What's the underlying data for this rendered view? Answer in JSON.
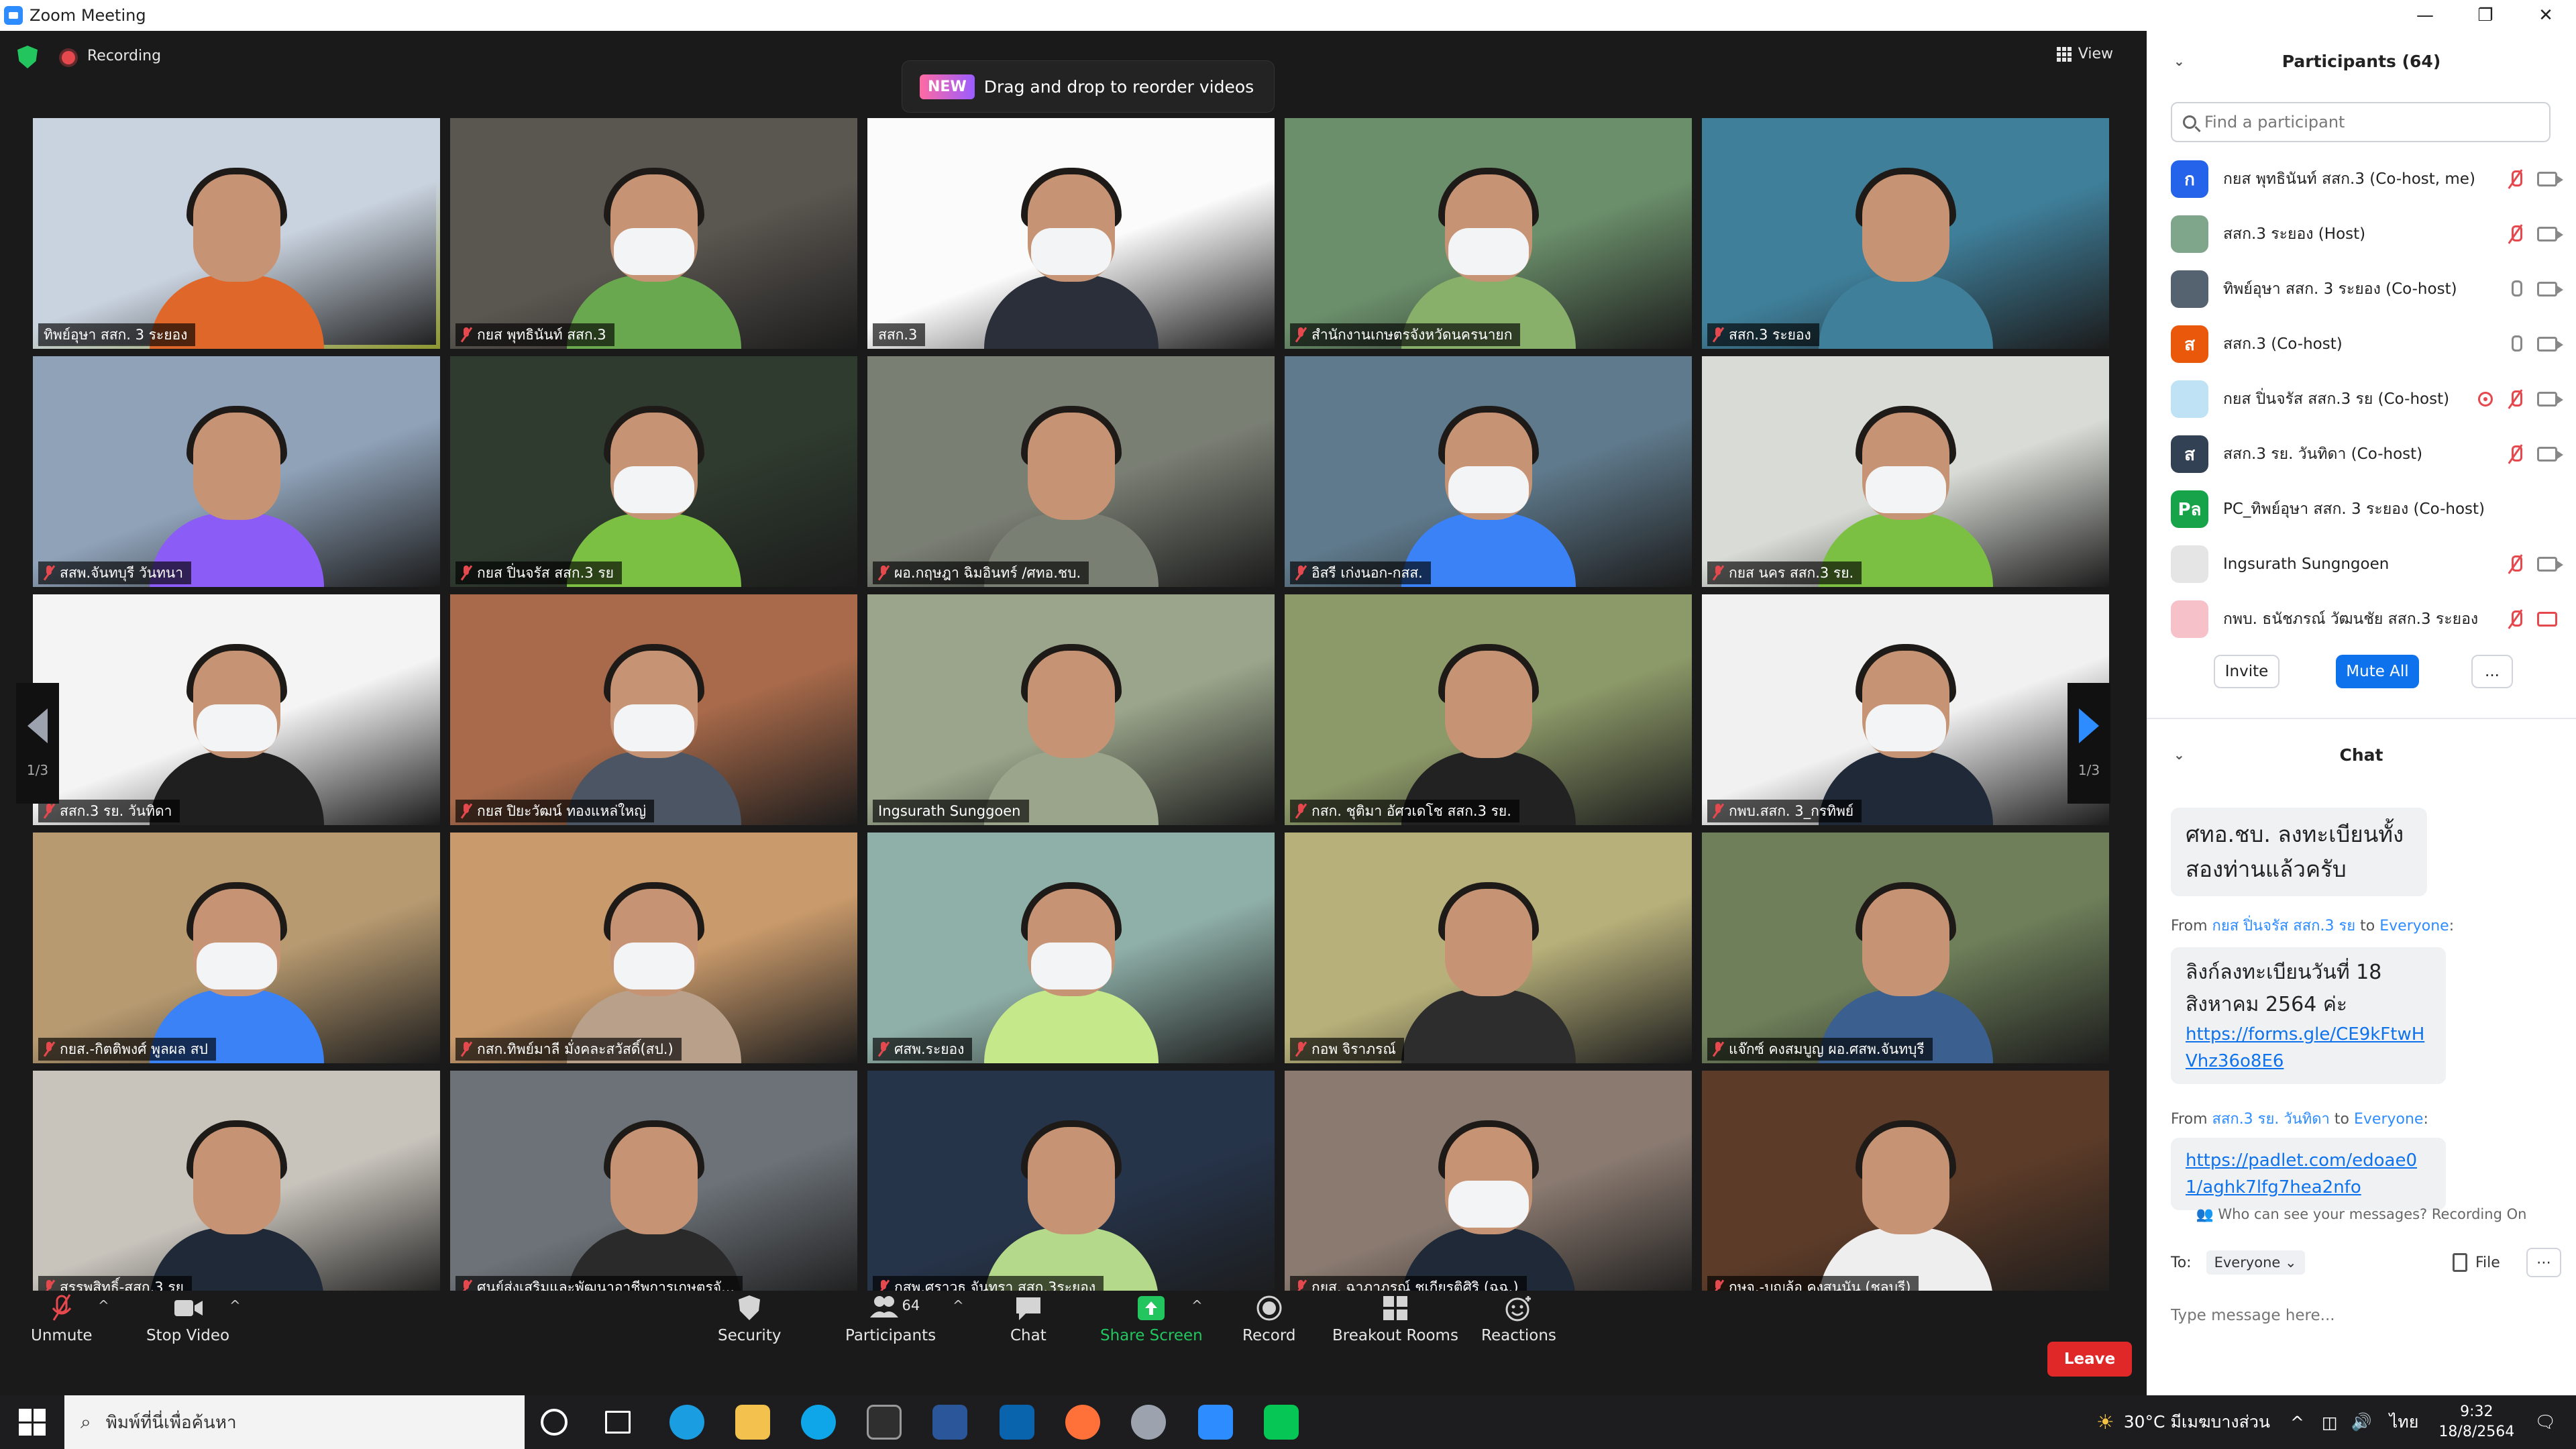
{
  "window": {
    "title": "Zoom Meeting",
    "buttons": [
      "—",
      "❐",
      "✕"
    ]
  },
  "topbar": {
    "recording_label": "Recording",
    "view_label": "View"
  },
  "banner": {
    "badge": "NEW",
    "text": "Drag and drop to reorder videos"
  },
  "gallery": {
    "page_indicator": "1/3",
    "tiles": [
      {
        "name": "ทิพย์อุษา สสก. 3 ระยอง",
        "muted": false,
        "active": true,
        "bg": "#c9d3df",
        "shirt": "#e0672a",
        "mask": false
      },
      {
        "name": "กยส พุทธินันท์ สสก.3",
        "muted": true,
        "active": false,
        "bg": "#5a5650",
        "shirt": "#6aa84f",
        "mask": true
      },
      {
        "name": "สสก.3",
        "muted": false,
        "active": false,
        "bg": "#fbfbfb",
        "shirt": "#2b2f3a",
        "mask": true
      },
      {
        "name": "สำนักงานเกษตรจังหวัดนครนายก",
        "muted": true,
        "active": false,
        "bg": "#6b8f6b",
        "shirt": "#88b06a",
        "mask": true
      },
      {
        "name": "สสก.3 ระยอง",
        "muted": true,
        "active": false,
        "bg": "#3f7f9a",
        "shirt": "#3f7f9a",
        "mask": false
      },
      {
        "name": "สสพ.จันทบุรี วันทนา",
        "muted": true,
        "active": false,
        "bg": "#8fa2b8",
        "shirt": "#8b5cf6",
        "mask": false
      },
      {
        "name": "กยส ปิ่นจรัส สสก.3 รย",
        "muted": true,
        "active": false,
        "bg": "#2f3b2f",
        "shirt": "#7bc043",
        "mask": true
      },
      {
        "name": "ผอ.กฤษฎา ฉิมอินทร์ /ศทอ.ชบ.",
        "muted": true,
        "active": false,
        "bg": "#7a7f74",
        "shirt": "#7a7f74",
        "mask": false
      },
      {
        "name": "อิสรี เก่งนอก-กสส.",
        "muted": true,
        "active": false,
        "bg": "#5f7a8c",
        "shirt": "#3b82f6",
        "mask": true
      },
      {
        "name": "กยส นคร สสก.3 รย.",
        "muted": true,
        "active": false,
        "bg": "#d9dcd6",
        "shirt": "#7bc043",
        "mask": true
      },
      {
        "name": "สสก.3 รย. วันทิดา",
        "muted": true,
        "active": false,
        "bg": "#f4f4f4",
        "shirt": "#1f1f1f",
        "mask": true
      },
      {
        "name": "กยส ปิยะวัฒน์ ทองแหล่ใหญ่",
        "muted": true,
        "active": false,
        "bg": "#a86a4a",
        "shirt": "#4b5563",
        "mask": true
      },
      {
        "name": "Ingsurath Sunggoen",
        "muted": false,
        "active": false,
        "bg": "#9aa58b",
        "shirt": "#9aa58b",
        "mask": false
      },
      {
        "name": "กสก. ชุติมา อัศวเดโช สสก.3 รย.",
        "muted": true,
        "active": false,
        "bg": "#8c9968",
        "shirt": "#222222",
        "mask": false
      },
      {
        "name": "กพบ.สสก. 3_กรทิพย์",
        "muted": true,
        "active": false,
        "bg": "#f1f1f1",
        "shirt": "#1f2937",
        "mask": true
      },
      {
        "name": "กยส.-กิตติพงศ์ พูลผล สป",
        "muted": true,
        "active": false,
        "bg": "#b79a70",
        "shirt": "#3b82f6",
        "mask": true
      },
      {
        "name": "กสก.ทิพย์มาลี มั่งคละสวัสดิ์(สป.)",
        "muted": true,
        "active": false,
        "bg": "#c99a6b",
        "shirt": "#b8a08a",
        "mask": true
      },
      {
        "name": "ศสพ.ระยอง",
        "muted": true,
        "active": false,
        "bg": "#8fb0a8",
        "shirt": "#c5e88a",
        "mask": true
      },
      {
        "name": "กอพ จิราภรณ์",
        "muted": true,
        "active": false,
        "bg": "#b7b07a",
        "shirt": "#2d2d2d",
        "mask": false
      },
      {
        "name": "แจ๊กซ์ คงสมบูญ ผอ.ศสพ.จันทบุรี",
        "muted": true,
        "active": false,
        "bg": "#6e7f5a",
        "shirt": "#3b5f8f",
        "mask": false
      },
      {
        "name": "สรรพสิทธิ์-สสก.3 รย",
        "muted": true,
        "active": false,
        "bg": "#c8c4bc",
        "shirt": "#1f2937",
        "mask": false
      },
      {
        "name": "ศูนย์ส่งเสริมและพัฒนาอาชีพการเกษตรจั...",
        "muted": true,
        "active": false,
        "bg": "#6c7278",
        "shirt": "#2a2a2a",
        "mask": false
      },
      {
        "name": "กสพ.ศราวุธ จันทรา สสก.3ระยอง",
        "muted": true,
        "active": false,
        "bg": "#26344a",
        "shirt": "#b5d98a",
        "mask": false
      },
      {
        "name": "กยส. ฉาภาภรณ์ ชูเกียรติศิริ (ฉฉ.)",
        "muted": true,
        "active": false,
        "bg": "#8a7a70",
        "shirt": "#1f2937",
        "mask": true
      },
      {
        "name": "กษจ.-บุญล้อ คงสุนนัน (ชลบุรี)",
        "muted": true,
        "active": false,
        "bg": "#5c3b28",
        "shirt": "#eeeeee",
        "mask": false
      }
    ]
  },
  "controls": {
    "unmute": "Unmute",
    "stop_video": "Stop Video",
    "security": "Security",
    "participants": "Participants",
    "participants_count": "64",
    "chat": "Chat",
    "share_screen": "Share Screen",
    "record": "Record",
    "breakout_rooms": "Breakout Rooms",
    "reactions": "Reactions",
    "leave": "Leave"
  },
  "participants_panel": {
    "title": "Participants (64)",
    "search_placeholder": "Find a participant",
    "list": [
      {
        "name": "กยส พุทธินันท์ สสก.3 (Co-host, me)",
        "avatar": "ก",
        "avatar_color": "#2563eb",
        "icons": [
          "mic-off",
          "cam"
        ]
      },
      {
        "name": "สสก.3 ระยอง (Host)",
        "avatar": "",
        "avatar_color": "#7fa58a",
        "icons": [
          "mic-off",
          "cam"
        ]
      },
      {
        "name": "ทิพย์อุษา สสก. 3 ระยอง (Co-host)",
        "avatar": "",
        "avatar_color": "#556270",
        "icons": [
          "mic",
          "cam"
        ]
      },
      {
        "name": "สสก.3 (Co-host)",
        "avatar": "ส",
        "avatar_color": "#ea580c",
        "icons": [
          "mic",
          "cam"
        ]
      },
      {
        "name": "กยส ปิ่นจรัส สสก.3 รย (Co-host)",
        "avatar": "",
        "avatar_color": "#bfe3f5",
        "icons": [
          "rec",
          "mic-off",
          "cam"
        ]
      },
      {
        "name": "สสก.3 รย. วันทิดา (Co-host)",
        "avatar": "ส",
        "avatar_color": "#334155",
        "icons": [
          "mic-off",
          "cam"
        ]
      },
      {
        "name": "PC_ทิพย์อุษา สสก. 3 ระยอง (Co-host)",
        "avatar": "Pล",
        "avatar_color": "#16a34a",
        "icons": []
      },
      {
        "name": "Ingsurath Sungngoen",
        "avatar": "",
        "avatar_color": "#e5e5e5",
        "icons": [
          "mic-off",
          "cam"
        ]
      },
      {
        "name": "กพบ. ธนัชภรณ์ วัฒนชัย สสก.3 ระยอง",
        "avatar": "",
        "avatar_color": "#f6c1c9",
        "icons": [
          "mic-off",
          "cam-off"
        ]
      }
    ],
    "invite": "Invite",
    "mute_all": "Mute All",
    "more": "..."
  },
  "chat_panel": {
    "title": "Chat",
    "messages": [
      {
        "from": "",
        "to": "",
        "text": "ศทอ.ชบ. ลงทะเบียนทั้งสองท่านแล้วครับ",
        "link": ""
      },
      {
        "from": "กยส ปิ่นจรัส สสก.3 รย",
        "to": "Everyone",
        "text": "ลิงก์ลงทะเบียนวันที่ 18 สิงหาคม 2564 ค่ะ",
        "link": "https://forms.gle/CE9kFtwHVhz36o8E6"
      },
      {
        "from": "สสก.3 รย. วันทิดา",
        "to": "Everyone",
        "text": "",
        "link": "https://padlet.com/edoae01/aghk7lfg7hea2nfo"
      }
    ],
    "from_word": "From",
    "to_word": "to",
    "visibility_note": "Who can see your messages? Recording On",
    "to_label": "To:",
    "to_value": "Everyone",
    "file_label": "File",
    "input_placeholder": "Type message here..."
  },
  "taskbar": {
    "search_placeholder": "พิมพ์ที่นี่เพื่อค้นหา",
    "weather": "30°C มีเมฆบางส่วน",
    "language": "ไทย",
    "time": "9:32",
    "date": "18/8/2564"
  }
}
